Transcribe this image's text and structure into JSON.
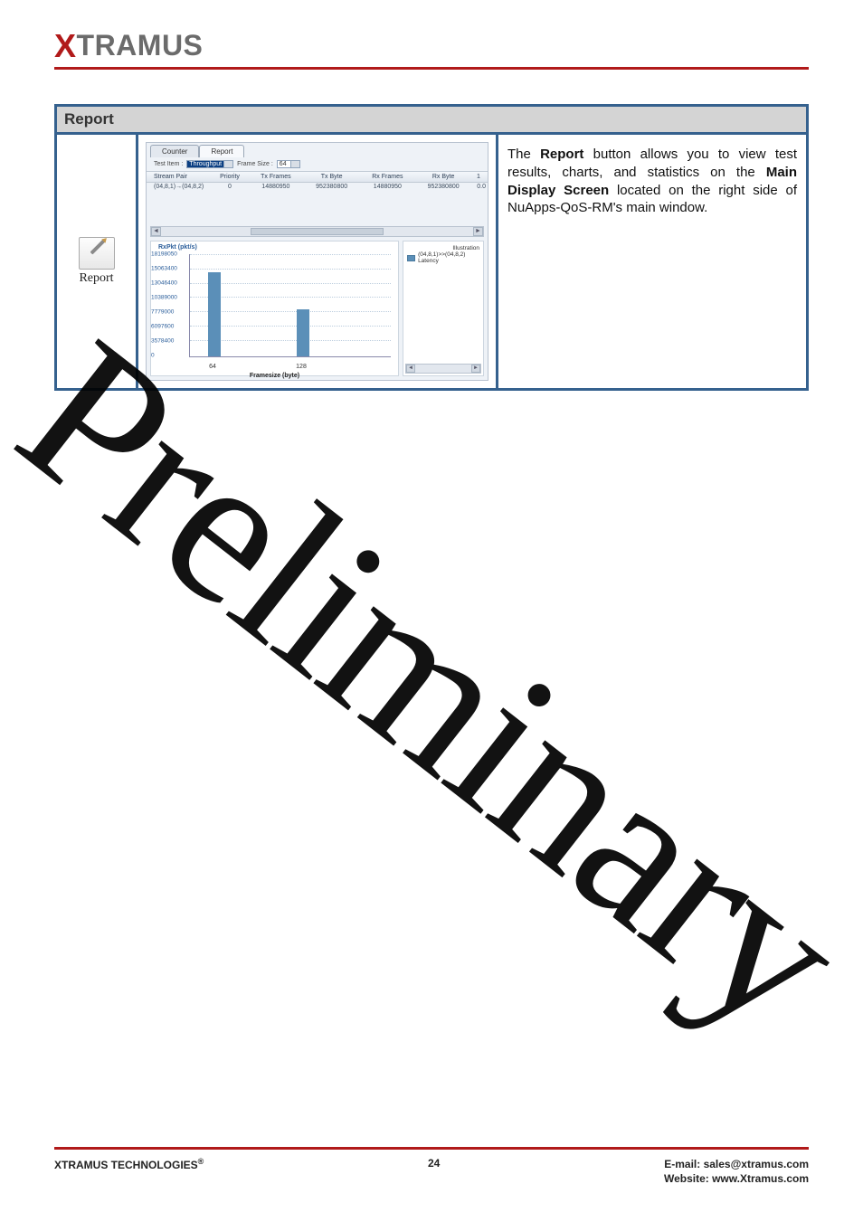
{
  "brand": {
    "x": "X",
    "rest": "TRAMUS"
  },
  "section_title": "Report",
  "left_button": {
    "label": "Report"
  },
  "app": {
    "tabs": {
      "counter": "Counter",
      "report": "Report"
    },
    "test_item_label": "Test Item :",
    "test_item_value": "Throughput",
    "frame_size_label": "Frame Size :",
    "frame_size_value": "64",
    "columns": {
      "stream_pair": "Stream Pair",
      "priority": "Priority",
      "tx_frames": "Tx Frames",
      "tx_byte": "Tx Byte",
      "rx_frames": "Rx Frames",
      "rx_byte": "Rx Byte",
      "last": "1"
    },
    "row": {
      "stream_pair": "(04,8,1)→(04,8,2)",
      "priority": "0",
      "tx_frames": "14880950",
      "tx_byte": "952380800",
      "rx_frames": "14880950",
      "rx_byte": "952380800",
      "last": "0.0"
    }
  },
  "chart_data": {
    "type": "bar",
    "title": "RxPkt (pkt/s)",
    "xlabel": "Framesize (byte)",
    "categories": [
      "64",
      "128"
    ],
    "values": [
      14880950,
      8445000
    ],
    "y_ticks": [
      "18198050",
      "15063400",
      "13046400",
      "10389000",
      "7779000",
      "6097600",
      "3578400",
      "0"
    ],
    "legend_title": "Illustration",
    "legend_series": "(04,8,1)>>(04,8,2) Latency"
  },
  "description": {
    "t1": "The ",
    "b1": "Report",
    "t2": " button allows you to view test results, charts, and statistics on the ",
    "b2": "Main Display Screen",
    "t3": " located on the right side of NuApps-QoS-RM's main window."
  },
  "watermark": "Preliminary",
  "footer": {
    "left": "XTRAMUS TECHNOLOGIES",
    "page": "24",
    "email_label": "E-mail: ",
    "email": "sales@xtramus.com",
    "web_label": "Website:  ",
    "web": "www.Xtramus.com"
  }
}
